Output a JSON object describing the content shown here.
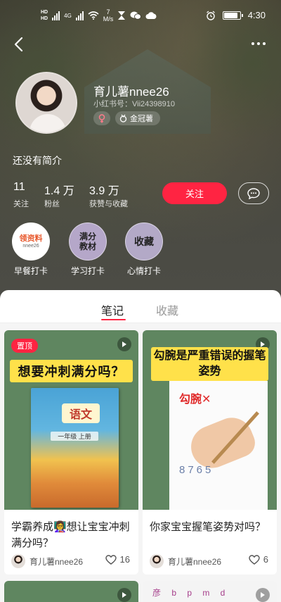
{
  "status_bar": {
    "hd_label": "HD",
    "network": "4G",
    "speed_value": "7",
    "speed_unit": "M/s",
    "time": "4:30",
    "battery_level": 0.8
  },
  "nav": {
    "back_icon": "chevron-left-icon",
    "more_icon": "more-horizontal-icon"
  },
  "profile": {
    "username": "育儿薯nnee26",
    "xhs_id": "小红书号：Vii24398910",
    "gender_icon": "female-icon",
    "badge_label": "金冠薯",
    "bio": "还没有简介"
  },
  "stats": [
    {
      "value": "11",
      "label": "关注"
    },
    {
      "value": "1.4 万",
      "label": "粉丝"
    },
    {
      "value": "3.9 万",
      "label": "获赞与收藏"
    }
  ],
  "actions": {
    "follow_label": "关注",
    "message_icon": "chat-bubble-icon"
  },
  "boards": [
    {
      "label": "早餐打卡",
      "thumb_text": "领资料",
      "thumb_sub": "nnee26"
    },
    {
      "label": "学习打卡",
      "thumb_line1": "满分",
      "thumb_line2": "教材"
    },
    {
      "label": "心情打卡",
      "thumb_text": "收藏"
    }
  ],
  "tabs": [
    {
      "label": "笔记",
      "active": true
    },
    {
      "label": "收藏",
      "active": false
    }
  ],
  "notes": [
    {
      "pinned_label": "置顶",
      "cover_headline": "想要冲刺满分吗？",
      "book_title": "语文",
      "book_grade": "一年级 上册",
      "title": "学霸养成👩‍🏫想让宝宝冲刺满分吗？",
      "author": "育儿薯nnee26",
      "likes": "16"
    },
    {
      "cover_headline": "勾腕是严重错误的握笔姿势",
      "cover_mark": "勾腕✕",
      "cover_numbers": "8765",
      "title": "你家宝宝握笔姿势对吗？",
      "author": "育儿薯nnee26",
      "likes": "6"
    }
  ],
  "partial_bottom": {
    "right_text": "彦 b p m d"
  },
  "colors": {
    "accent": "#ff2442",
    "cover_green": "#5f8660",
    "headline_yellow": "#ffe14a"
  }
}
